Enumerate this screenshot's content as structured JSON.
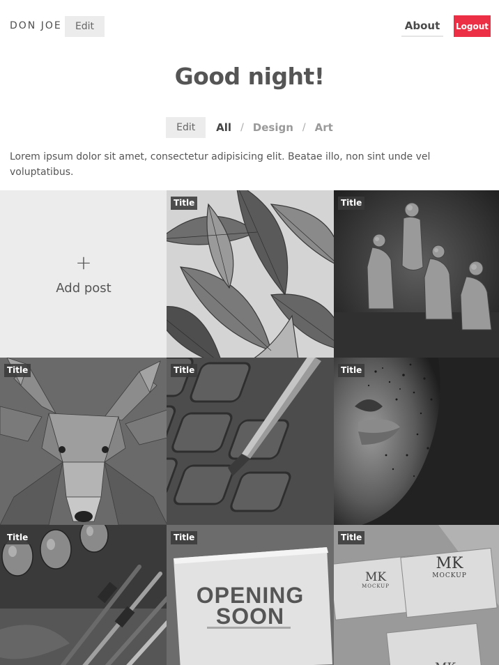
{
  "header": {
    "brand": "DON JOE",
    "edit_label": "Edit",
    "about_label": "About",
    "logout_label": "Logout",
    "logout_color": "#ec2f45"
  },
  "greeting": "Good night!",
  "filters": {
    "edit_label": "Edit",
    "items": [
      "All",
      "Design",
      "Art"
    ],
    "active": "All",
    "separator": "/"
  },
  "intro": "Lorem ipsum dolor sit amet, consectetur adipisicing elit. Beatae illo, non sint unde vel voluptatibus.",
  "add_post": {
    "icon": "plus-icon",
    "plus": "+",
    "label": "Add post"
  },
  "posts": [
    {
      "title": "Title",
      "image": "tropical-leaves"
    },
    {
      "title": "Title",
      "image": "figures-sculpture"
    },
    {
      "title": "Title",
      "image": "low-poly-deer"
    },
    {
      "title": "Title",
      "image": "paint-palette-brush"
    },
    {
      "title": "Title",
      "image": "freckled-face"
    },
    {
      "title": "Title",
      "image": "paint-tubes-brushes"
    },
    {
      "title": "Title",
      "image": "opening-soon-poster"
    },
    {
      "title": "Title",
      "image": "business-card-mockup"
    }
  ],
  "poster_text": [
    "OPENING",
    "SOON"
  ],
  "mockup_text": {
    "logo": "MK",
    "word": "MOCKUP"
  }
}
